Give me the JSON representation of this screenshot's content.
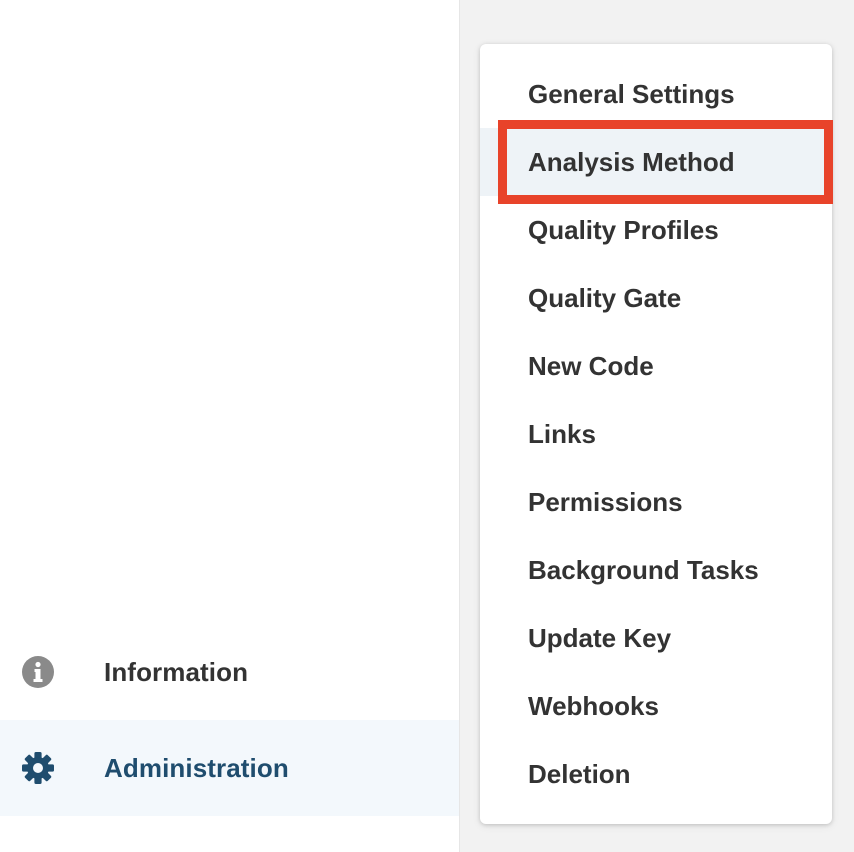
{
  "sidebar": {
    "items": [
      {
        "label": "Information",
        "icon": "info-circle-icon",
        "icon_color": "#8a8a8a"
      },
      {
        "label": "Administration",
        "icon": "gear-icon",
        "icon_color": "#1f4d6e",
        "selected": true
      }
    ]
  },
  "menu": {
    "items": [
      {
        "label": "General Settings"
      },
      {
        "label": "Analysis Method",
        "active": true
      },
      {
        "label": "Quality Profiles"
      },
      {
        "label": "Quality Gate"
      },
      {
        "label": "New Code"
      },
      {
        "label": "Links"
      },
      {
        "label": "Permissions"
      },
      {
        "label": "Background Tasks"
      },
      {
        "label": "Update Key"
      },
      {
        "label": "Webhooks"
      },
      {
        "label": "Deletion"
      }
    ]
  },
  "colors": {
    "highlight_border": "#e8432a",
    "text": "#333333",
    "accent": "#1f4d6e",
    "panel_bg": "#f2f2f2",
    "selected_bg": "#f3f8fc"
  }
}
